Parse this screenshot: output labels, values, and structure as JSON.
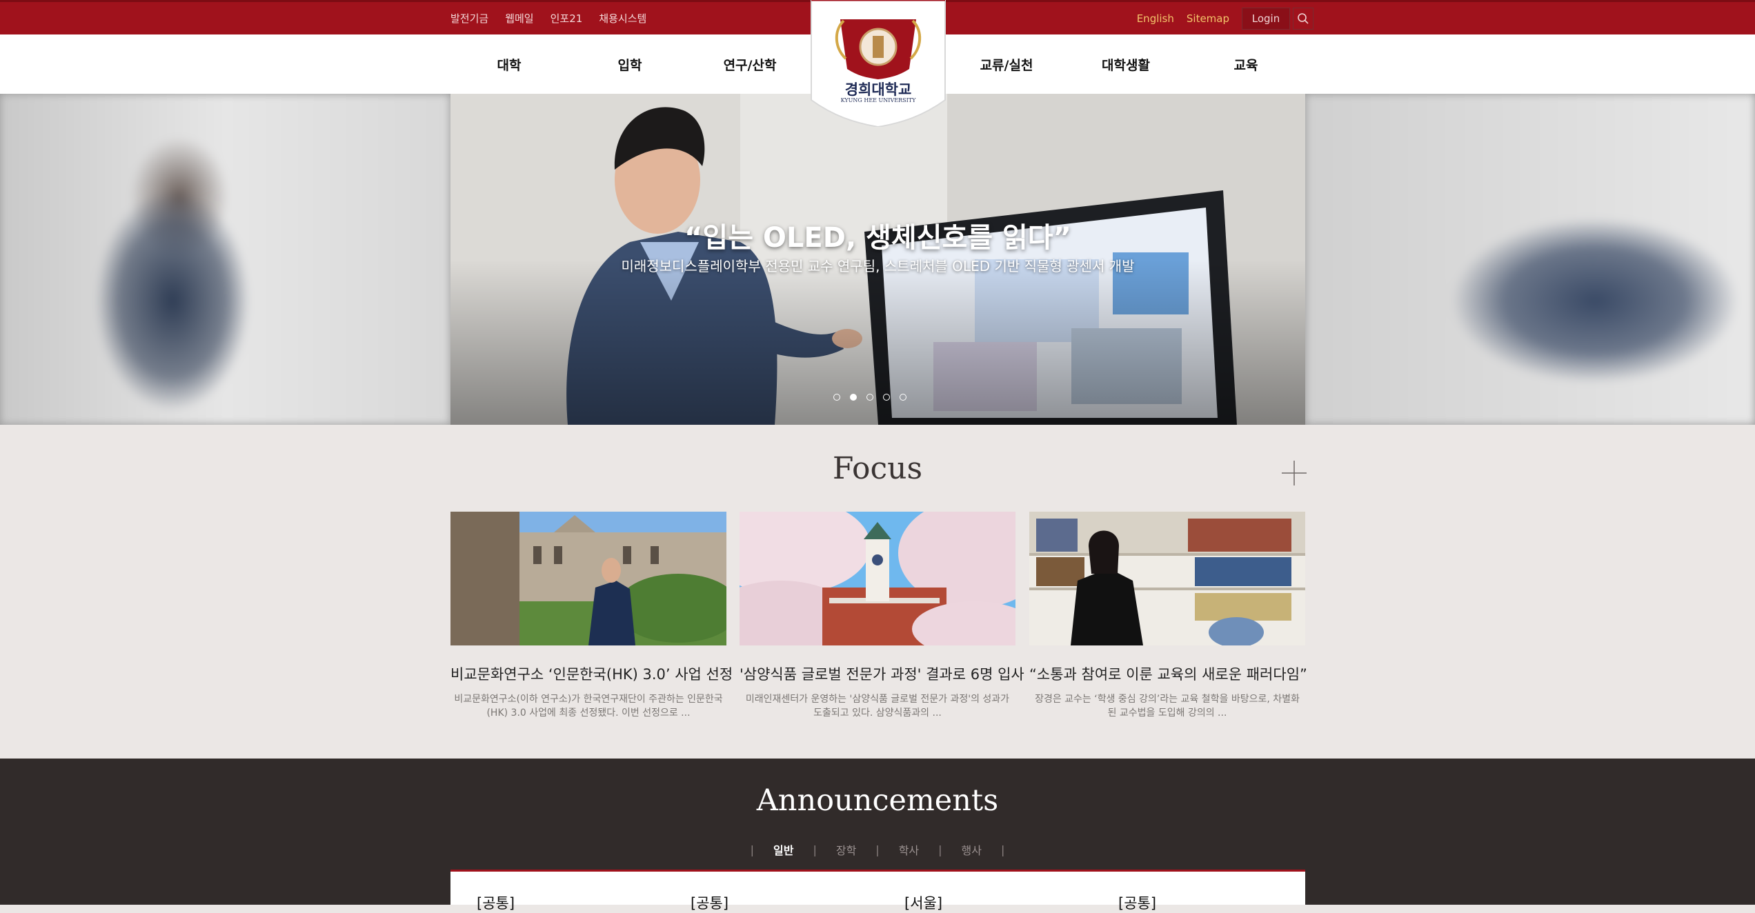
{
  "topbar": {
    "links": [
      "발전기금",
      "웹메일",
      "인포21",
      "채용시스템"
    ],
    "english": "English",
    "sitemap": "Sitemap",
    "login": "Login"
  },
  "logo": {
    "name_ko": "경희대학교",
    "name_en": "KYUNG HEE UNIVERSITY"
  },
  "nav": {
    "items": [
      "대학",
      "입학",
      "연구/산학",
      "교류/실천",
      "대학생활",
      "교육"
    ]
  },
  "hero": {
    "title": "“입는 OLED, 생체신호를 읽다”",
    "subtitle": "미래정보디스플레이학부 전용민 교수 연구팀, 스트레처블 OLED 기반 직물형 광센서 개발",
    "slides": 5,
    "active_slide": 2
  },
  "focus": {
    "title": "Focus",
    "cards": [
      {
        "title": "비교문화연구소 ‘인문한국(HK) 3.0’ 사업 선정",
        "desc": "비교문화연구소(이하 연구소)가 한국연구재단이 주관하는 인문한국(HK) 3.0 사업에 최종 선정됐다. 이번 선정으로 ..."
      },
      {
        "title": "'삼양식품 글로벌 전문가 과정' 결과로 6명 입사",
        "desc": "미래인재센터가 운영하는 '삼양식품 글로벌 전문가 과정'의 성과가 도출되고 있다. 삼양식품과의 ..."
      },
      {
        "title": "“소통과 참여로 이룬 교육의 새로운 패러다임”",
        "desc": "장경은 교수는 ‘학생 중심 강의’라는 교육 철학을 바탕으로, 차별화된 교수법을 도입해 강의의 ..."
      }
    ]
  },
  "announcements": {
    "title": "Announcements",
    "tabs": [
      "일반",
      "장학",
      "학사",
      "행사"
    ],
    "active_tab": "일반",
    "columns": [
      "[공통]",
      "[공통]",
      "[서울]",
      "[공통]"
    ]
  },
  "colors": {
    "brand_red": "#a0121c",
    "gold": "#f3c46a",
    "dark": "#312b2a",
    "focus_bg": "#ebe7e5"
  }
}
